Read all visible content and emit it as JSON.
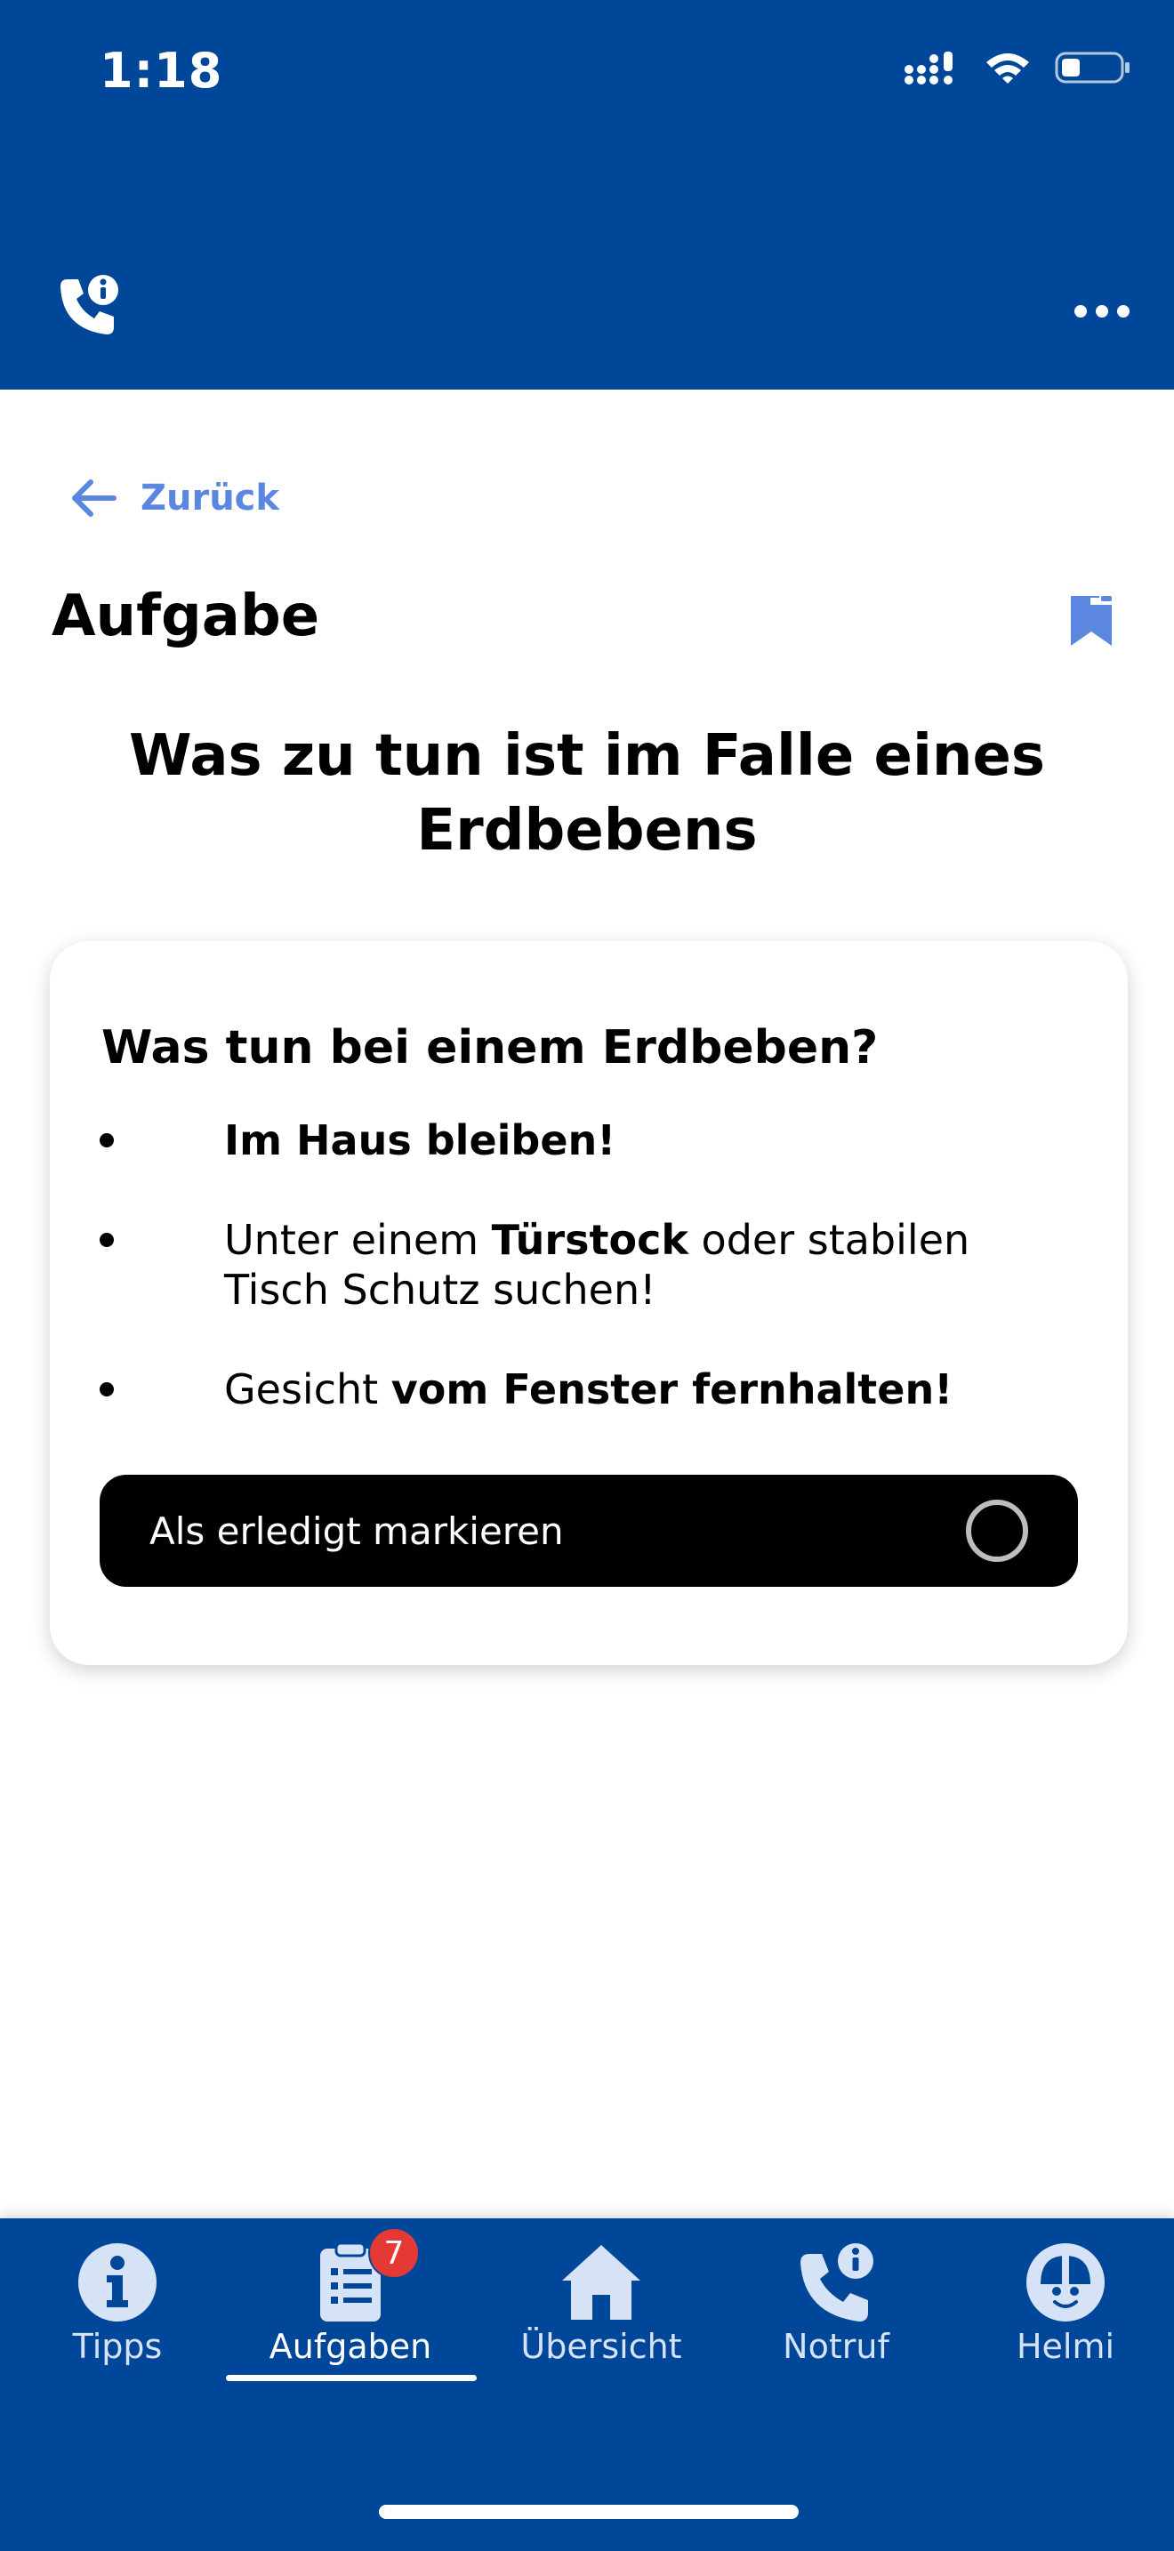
{
  "status_bar": {
    "time": "1:18"
  },
  "content": {
    "back_label": "Zurück",
    "page_title": "Aufgabe",
    "task_title": "Was zu tun ist im Falle eines Erdbebens",
    "card": {
      "heading": "Was tun bei einem Erdbeben?",
      "bullets": [
        {
          "parts": [
            {
              "text": "Im Haus bleiben!",
              "bold": true
            }
          ]
        },
        {
          "parts": [
            {
              "text": "Unter einem ",
              "bold": false
            },
            {
              "text": "Türstock",
              "bold": true
            },
            {
              "text": " oder stabilen Tisch Schutz suchen!",
              "bold": false
            }
          ]
        },
        {
          "parts": [
            {
              "text": "Gesicht ",
              "bold": false
            },
            {
              "text": "vom Fenster fernhalten!",
              "bold": true
            }
          ]
        }
      ],
      "done_button_label": "Als erledigt markieren"
    }
  },
  "bottom_nav": {
    "items": [
      {
        "label": "Tipps",
        "icon": "info-icon"
      },
      {
        "label": "Aufgaben",
        "icon": "clipboard-icon",
        "badge": "7",
        "active": true
      },
      {
        "label": "Übersicht",
        "icon": "home-icon"
      },
      {
        "label": "Notruf",
        "icon": "phone-info-icon"
      },
      {
        "label": "Helmi",
        "icon": "helmi-icon"
      }
    ]
  },
  "colors": {
    "primary": "#00479A",
    "accent": "#5B87E0",
    "badge": "#E53935"
  }
}
